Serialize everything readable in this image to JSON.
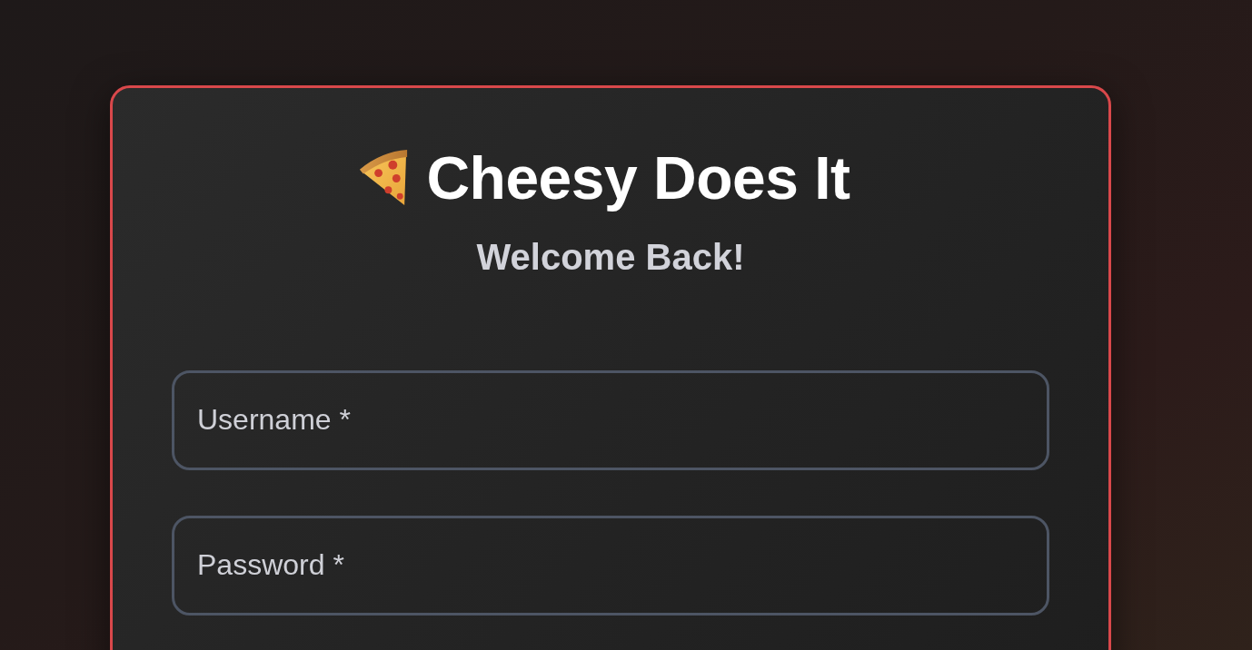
{
  "login_card": {
    "title": "Cheesy Does It",
    "subtitle": "Welcome Back!",
    "fields": [
      {
        "placeholder": "Username *"
      },
      {
        "placeholder": "Password *"
      }
    ]
  }
}
